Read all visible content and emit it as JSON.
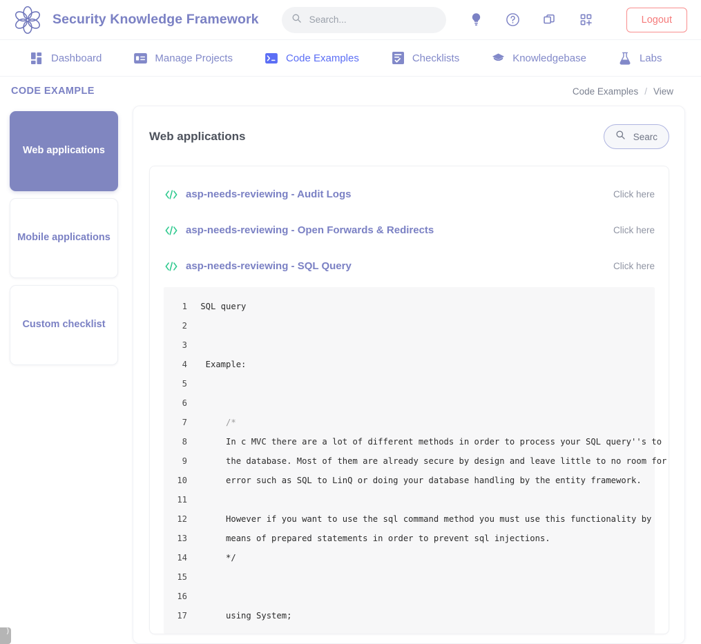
{
  "header": {
    "brand_title": "Security Knowledge Framework",
    "logo_icon": "flower-logo",
    "search": {
      "placeholder": "Search...",
      "value": "",
      "icon": "search-icon"
    },
    "actions": [
      {
        "name": "lightbulb-icon",
        "label": "Tips"
      },
      {
        "name": "question-circle-icon",
        "label": "Help"
      },
      {
        "name": "copy-icon",
        "label": "Duplicate"
      },
      {
        "name": "grid-plus-icon",
        "label": "Add"
      }
    ],
    "logout_label": "Logout",
    "accent_color": "#7b81c4",
    "logout_color": "#f57b7b"
  },
  "nav": {
    "items": [
      {
        "label": "Dashboard",
        "icon": "dashboard-grid-icon",
        "active": false
      },
      {
        "label": "Manage Projects",
        "icon": "projects-card-icon",
        "active": false
      },
      {
        "label": "Code Examples",
        "icon": "terminal-icon",
        "active": true
      },
      {
        "label": "Checklists",
        "icon": "checklist-icon",
        "active": false
      },
      {
        "label": "Knowledgebase",
        "icon": "graduation-cap-icon",
        "active": false
      },
      {
        "label": "Labs",
        "icon": "flask-icon",
        "active": false
      }
    ],
    "active_color": "#5b6ef5"
  },
  "breadcrumb": {
    "kicker": "CODE EXAMPLE",
    "trail": [
      "Code Examples",
      "View"
    ],
    "separator": "/"
  },
  "sidebar": {
    "cards": [
      {
        "label": "Web applications",
        "active": true
      },
      {
        "label": "Mobile applications",
        "active": false
      },
      {
        "label": "Custom checklist",
        "active": false
      }
    ],
    "active_bg": "#8086c0"
  },
  "main": {
    "title": "Web applications",
    "search_button": {
      "label": "Searc",
      "icon": "search-icon"
    },
    "items": [
      {
        "icon": "code-tags-icon",
        "title": "asp-needs-reviewing - Audit Logs",
        "action_label": "Click here"
      },
      {
        "icon": "code-tags-icon",
        "title": "asp-needs-reviewing - Open Forwards & Redirects",
        "action_label": "Click here"
      },
      {
        "icon": "code-tags-icon",
        "title": "asp-needs-reviewing - SQL Query",
        "action_label": "Click here"
      }
    ],
    "code_block": {
      "lines": [
        {
          "n": "1",
          "text": " SQL query",
          "comment": false
        },
        {
          "n": "2",
          "text": "",
          "comment": false
        },
        {
          "n": "3",
          "text": "",
          "comment": false
        },
        {
          "n": "4",
          "text": "  Example:",
          "comment": false
        },
        {
          "n": "5",
          "text": "",
          "comment": false
        },
        {
          "n": "6",
          "text": "",
          "comment": false
        },
        {
          "n": "7",
          "text": "      /*",
          "comment": true
        },
        {
          "n": "8",
          "text": "      In c MVC there are a lot of different methods in order to process your SQL query''s to",
          "comment": false
        },
        {
          "n": "9",
          "text": "      the database. Most of them are already secure by design and leave little to no room for",
          "comment": false
        },
        {
          "n": "10",
          "text": "      error such as SQL to LinQ or doing your database handling by the entity framework.",
          "comment": false
        },
        {
          "n": "11",
          "text": "",
          "comment": false
        },
        {
          "n": "12",
          "text": "      However if you want to use the sql command method you must use this functionality by",
          "comment": false
        },
        {
          "n": "13",
          "text": "      means of prepared statements in order to prevent sql injections.",
          "comment": false
        },
        {
          "n": "14",
          "text": "      */",
          "comment": false
        },
        {
          "n": "15",
          "text": "",
          "comment": false
        },
        {
          "n": "16",
          "text": "",
          "comment": false
        },
        {
          "n": "17",
          "text": "      using System;",
          "comment": false
        }
      ]
    }
  },
  "corner_badge": {
    "label": ")"
  }
}
